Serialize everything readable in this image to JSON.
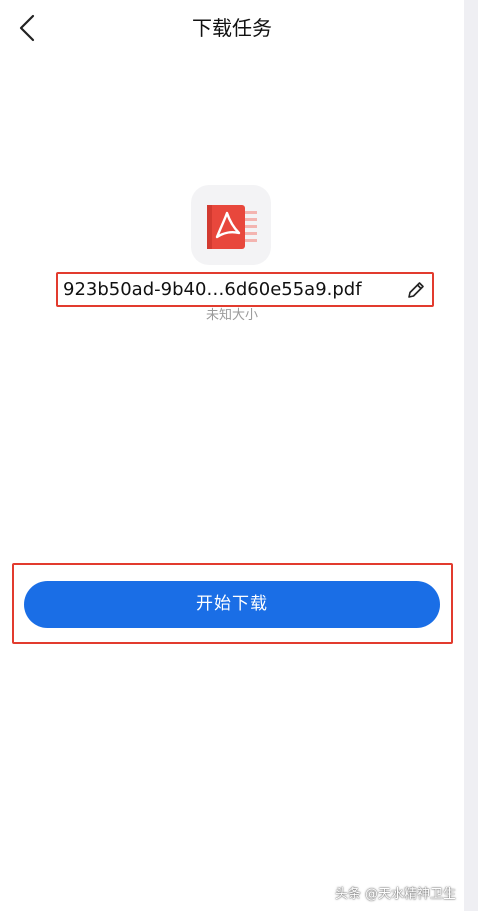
{
  "header": {
    "title": "下载任务",
    "back_icon": "chevron-left-icon"
  },
  "file": {
    "icon": "pdf-file-icon",
    "name": "923b50ad-9b40…6d60e55a9.pdf",
    "size_label": "未知大小",
    "edit_icon": "pencil-icon"
  },
  "actions": {
    "start_download_label": "开始下载"
  },
  "watermark": {
    "text": "头条 @天水精神卫生"
  },
  "colors": {
    "accent": "#1a6ee6",
    "highlight_border": "#e23b2e",
    "pdf_red": "#e8473c"
  }
}
